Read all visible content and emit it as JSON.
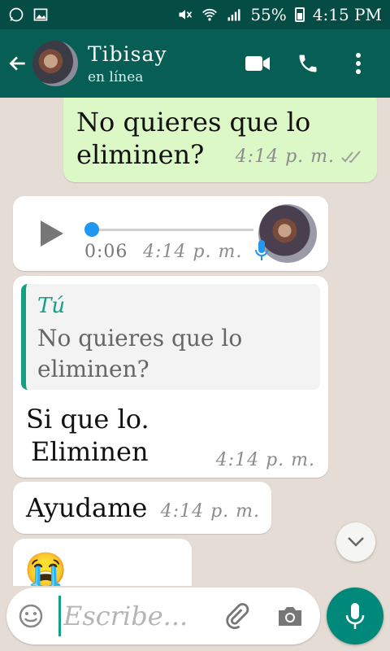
{
  "status_bar": {
    "battery": "55%",
    "time": "4:15 PM",
    "icons": [
      "whatsapp-icon",
      "image-icon",
      "mute-icon",
      "wifi-icon",
      "signal-icon",
      "battery-icon"
    ]
  },
  "header": {
    "contact_name": "Tibisay",
    "status": "en línea",
    "icons": [
      "back-arrow-icon",
      "video-call-icon",
      "phone-icon",
      "more-vert-icon"
    ]
  },
  "messages": [
    {
      "type": "outgoing",
      "text_line1": "No quieres que lo",
      "text_line2": "eliminen?",
      "time": "4:14 p. m.",
      "status": "read-ticks"
    },
    {
      "type": "incoming-voice",
      "duration": "0:06",
      "time": "4:14 p. m.",
      "progress": 0
    },
    {
      "type": "incoming-reply",
      "quote_author": "Tú",
      "quote_line1": "No quieres que lo",
      "quote_line2": "eliminen?",
      "text_line1": "Si que lo.",
      "text_line2": "Eliminen",
      "time": "4:14 p. m."
    },
    {
      "type": "incoming",
      "text": "Ayudame",
      "time": "4:14 p. m."
    },
    {
      "type": "incoming",
      "text": "😭",
      "time": ""
    }
  ],
  "input": {
    "placeholder": "Escribe..."
  },
  "colors": {
    "header": "#075e54",
    "status_bar": "#054d44",
    "outgoing_bubble": "#dcf8c6",
    "accent": "#14a083",
    "fab": "#00897b"
  }
}
